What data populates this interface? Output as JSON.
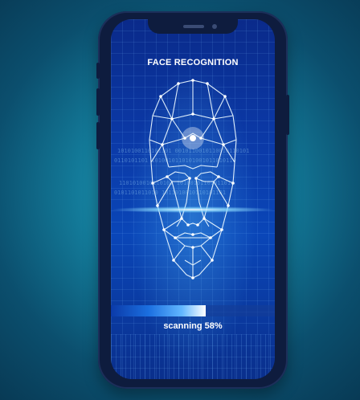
{
  "screen": {
    "title": "FACE RECOGNITION",
    "status_text": "scanning 58%",
    "progress": 0.58
  },
  "colors": {
    "background": "#137a99",
    "phone_body": "#0e1c3e",
    "screen_blue": "#0b3aa8",
    "mesh": "#e8f6ff"
  },
  "icons": {
    "face_mesh": "face-mesh-icon"
  }
}
